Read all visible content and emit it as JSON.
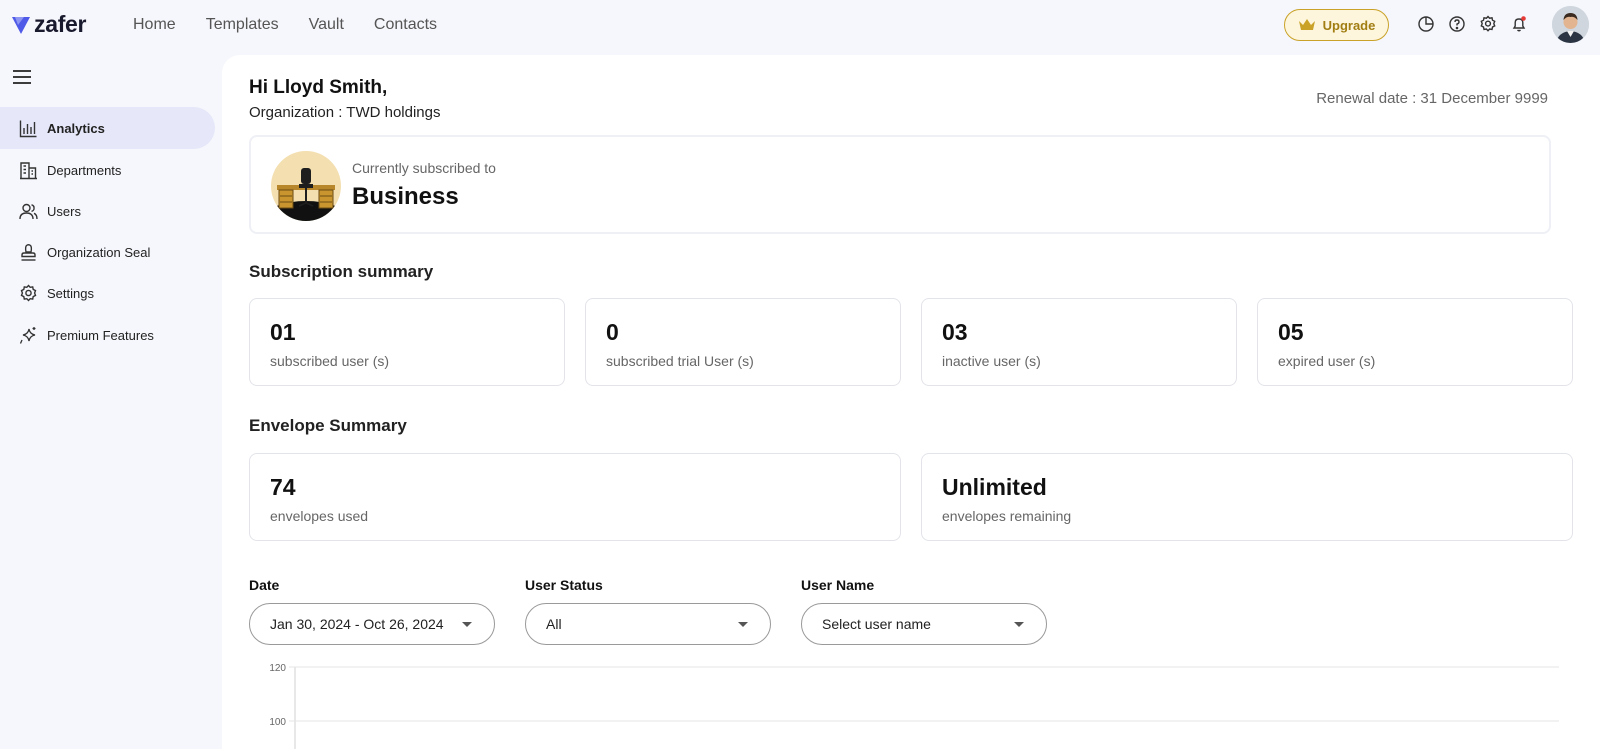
{
  "brand": {
    "name": "zafer",
    "accent": "#4f5ae8"
  },
  "nav": {
    "items": [
      "Home",
      "Templates",
      "Vault",
      "Contacts"
    ]
  },
  "topbar": {
    "upgrade_label": "Upgrade",
    "icons": [
      "pie-chart-icon",
      "help-icon",
      "gear-icon",
      "bell-icon"
    ]
  },
  "sidebar": {
    "items": [
      {
        "label": "Analytics",
        "icon": "bar-chart-icon",
        "active": true
      },
      {
        "label": "Departments",
        "icon": "building-icon"
      },
      {
        "label": "Users",
        "icon": "users-icon"
      },
      {
        "label": "Organization Seal",
        "icon": "stamp-icon"
      },
      {
        "label": "Settings",
        "icon": "gear-icon"
      },
      {
        "label": "Premium Features",
        "icon": "sparkle-icon"
      }
    ]
  },
  "header": {
    "greeting": "Hi Lloyd Smith,",
    "organization": "Organization : TWD holdings",
    "renewal": "Renewal date : 31 December 9999"
  },
  "plan": {
    "subtitle": "Currently subscribed to",
    "name": "Business"
  },
  "subscription_summary": {
    "title": "Subscription summary",
    "cards": [
      {
        "value": "01",
        "label": "subscribed user (s)"
      },
      {
        "value": "0",
        "label": "subscribed trial User (s)"
      },
      {
        "value": "03",
        "label": "inactive user (s)"
      },
      {
        "value": "05",
        "label": "expired user (s)"
      }
    ]
  },
  "envelope_summary": {
    "title": "Envelope Summary",
    "cards": [
      {
        "value": "74",
        "label": "envelopes used"
      },
      {
        "value": "Unlimited",
        "label": "envelopes remaining"
      }
    ]
  },
  "filters": {
    "date": {
      "label": "Date",
      "value": "Jan 30, 2024 - Oct 26, 2024"
    },
    "status": {
      "label": "User Status",
      "value": "All"
    },
    "user": {
      "label": "User Name",
      "placeholder": "Select user name"
    }
  },
  "chart_data": {
    "type": "line",
    "title": "",
    "xlabel": "",
    "ylabel": "",
    "y_ticks": [
      "120",
      "100"
    ],
    "ylim": [
      0,
      120
    ],
    "grid": true,
    "series": []
  }
}
